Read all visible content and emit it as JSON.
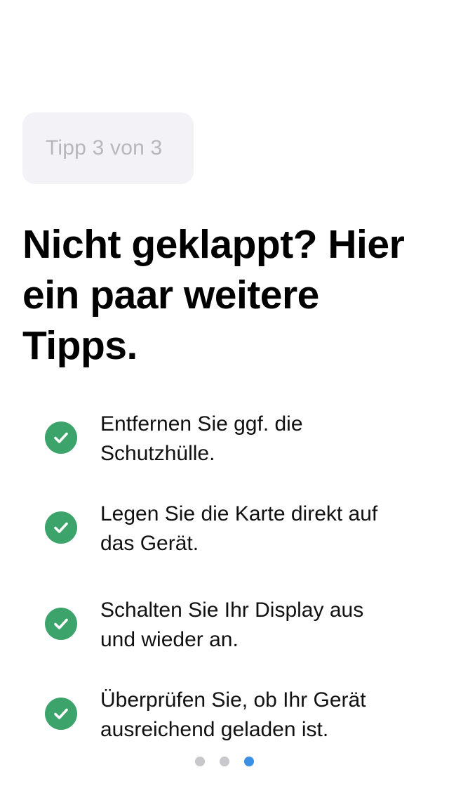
{
  "step_badge": {
    "text": "Tipp 3 von 3"
  },
  "headline": "Nicht geklappt? Hier ein paar weitere Tipps.",
  "tips": [
    {
      "text": "Entfernen Sie ggf. die Schutzhülle.",
      "icon": "checkmark-circle-icon"
    },
    {
      "text": "Legen Sie die Karte direkt auf das Gerät.",
      "icon": "checkmark-circle-icon"
    },
    {
      "text": "Schalten Sie Ihr Display aus und wieder an.",
      "icon": "checkmark-circle-icon"
    },
    {
      "text": "Überprüfen Sie, ob Ihr Gerät ausreichend geladen ist.",
      "icon": "checkmark-circle-icon"
    }
  ],
  "pagination": {
    "total": 3,
    "current": 3
  },
  "colors": {
    "check_green": "#3ca36a",
    "badge_background": "#f2f2f7",
    "badge_text": "#b7b7bd",
    "dot_inactive": "#c7c7cc",
    "dot_active": "#3b8fe5"
  }
}
